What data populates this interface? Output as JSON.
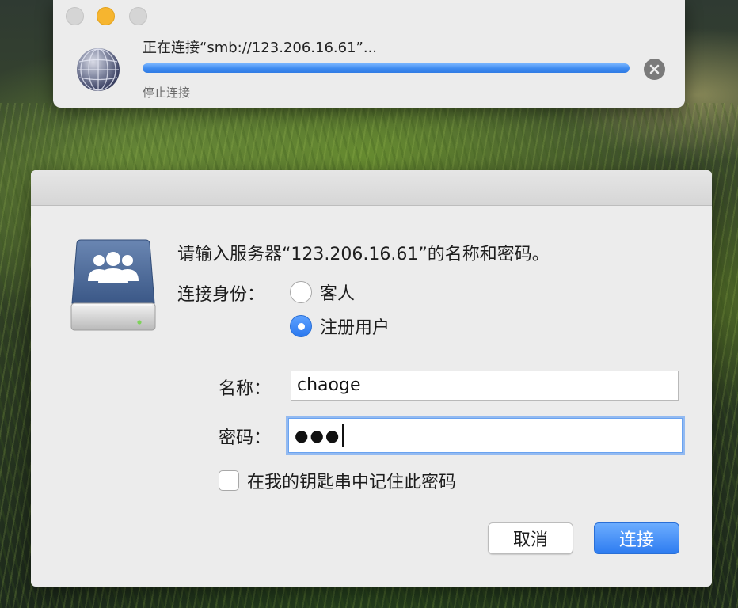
{
  "progress_window": {
    "connecting_text": "正在连接“smb://123.206.16.61”...",
    "progress": 1.0,
    "stop_label": "停止连接",
    "colors": {
      "traffic_close": "#d5d5d5",
      "traffic_min": "#f6b52f",
      "traffic_zoom": "#d5d5d5",
      "progress": "#3f8bf0"
    },
    "icons": {
      "app": "network-globe-icon",
      "stop": "stop-circle-icon"
    }
  },
  "login_dialog": {
    "prompt": "请输入服务器“123.206.16.61”的名称和密码。",
    "connect_as_label": "连接身份：",
    "options": [
      {
        "label": "客人",
        "selected": false
      },
      {
        "label": "注册用户",
        "selected": true
      }
    ],
    "name_label": "名称：",
    "name_value": "chaoge",
    "password_label": "密码：",
    "password_mask": "●●●",
    "remember_label": "在我的钥匙串中记住此密码",
    "remember_checked": false,
    "cancel_label": "取消",
    "connect_label": "连接",
    "icons": {
      "server": "shared-server-users-icon"
    },
    "colors": {
      "accent": "#2e7cf0",
      "server_blue": "#41618f"
    }
  }
}
